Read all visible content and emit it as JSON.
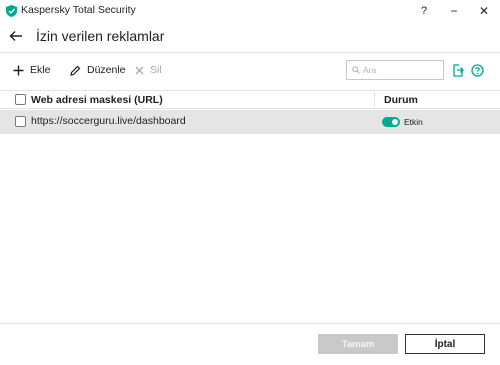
{
  "window": {
    "title": "Kaspersky Total Security",
    "help_label": "?",
    "minimize_label": "−",
    "close_label": "✕"
  },
  "header": {
    "title": "İzin verilen reklamlar"
  },
  "toolbar": {
    "add_label": "Ekle",
    "edit_label": "Düzenle",
    "delete_label": "Sil"
  },
  "search": {
    "placeholder": "Ara",
    "value": ""
  },
  "table": {
    "columns": [
      "Web adresi maskesi (URL)",
      "Durum"
    ],
    "rows": [
      {
        "url": "https://soccerguru.live/dashboard",
        "status": "Etkin",
        "enabled": true,
        "selected": true
      }
    ]
  },
  "footer": {
    "ok_label": "Tamam",
    "cancel_label": "İptal"
  },
  "colors": {
    "brand": "#00a88e",
    "row_highlight": "#e5e5e5",
    "disabled_button": "#c9c9c9"
  }
}
